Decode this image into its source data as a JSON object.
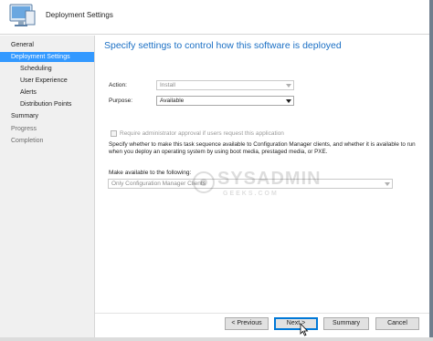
{
  "window": {
    "title": "Deployment Settings",
    "icon": "computer-icon"
  },
  "sidebar": {
    "items": [
      {
        "label": "General",
        "state": "normal"
      },
      {
        "label": "Deployment Settings",
        "state": "active"
      },
      {
        "label": "Scheduling",
        "state": "normal"
      },
      {
        "label": "User Experience",
        "state": "normal"
      },
      {
        "label": "Alerts",
        "state": "normal"
      },
      {
        "label": "Distribution Points",
        "state": "normal"
      },
      {
        "label": "Summary",
        "state": "normal"
      },
      {
        "label": "Progress",
        "state": "disabled"
      },
      {
        "label": "Completion",
        "state": "disabled"
      }
    ]
  },
  "main": {
    "heading": "Specify settings to control how this software is deployed",
    "action": {
      "label": "Action:",
      "value": "Install"
    },
    "purpose": {
      "label": "Purpose:",
      "value": "Available"
    },
    "approval_checkbox": {
      "label": "Require administrator approval if users request this application",
      "checked": false
    },
    "description": "Specify whether to make this task sequence available to Configuration Manager clients, and whether it is available to run when you deploy an operating system by using boot media, prestaged media, or PXE.",
    "make_available": {
      "label": "Make available to the following:",
      "value": "Only Configuration Manager Clients"
    }
  },
  "watermark": {
    "title": "SYSADMIN",
    "subtitle": "GEEKS.COM"
  },
  "footer": {
    "previous": "< Previous",
    "next": "Next >",
    "summary": "Summary",
    "cancel": "Cancel"
  },
  "colors": {
    "accent": "#3399ff",
    "heading": "#1a6fc4",
    "sidebar_bg": "#f0f0f0"
  }
}
